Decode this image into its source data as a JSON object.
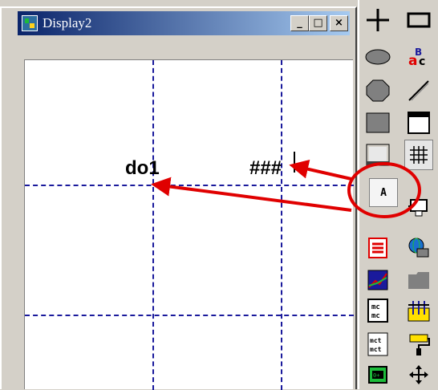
{
  "window": {
    "title": "Display2",
    "minimize_glyph": "_",
    "maximize_glyph": "□",
    "close_glyph": "×"
  },
  "canvas": {
    "label_tag": "do1",
    "label_value": "###"
  },
  "toolbox": {
    "text_tool_glyph": "A",
    "tools": [
      "line-tool",
      "rectangle-tool",
      "ellipse-tool",
      "text-style-tool",
      "rounded-rect-tool",
      "pen-tool",
      "filled-rect-tool",
      "window-tool",
      "bitmap-tool",
      "grid-tool",
      "text-tool",
      "monitor-tool",
      "list-tool",
      "network-tool",
      "trend-tool",
      "folder-tool",
      "meter-tool",
      "align-tool",
      "meter-tool-2",
      "paint-roller-tool",
      "digital-output-tool",
      "move-tool"
    ]
  },
  "annotations": {
    "highlight_color": "#e00000"
  }
}
